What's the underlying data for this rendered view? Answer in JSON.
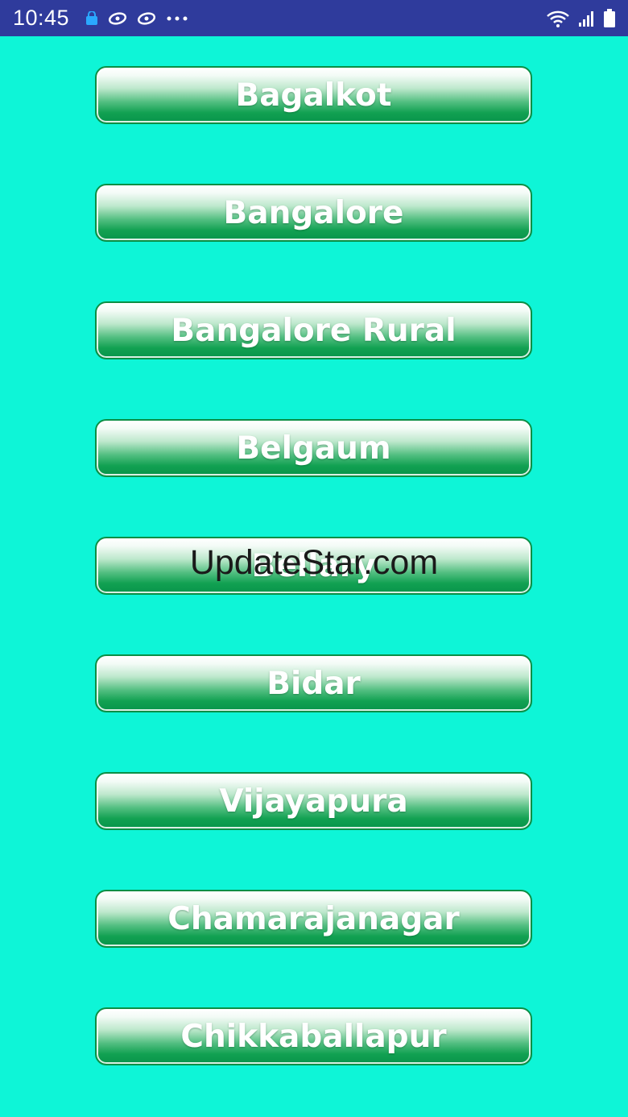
{
  "status_bar": {
    "time": "10:45",
    "background_color": "#2f3b9c",
    "left_icons": [
      "bag-icon",
      "swirl-icon",
      "swirl-icon",
      "more-dots-icon"
    ],
    "right_icons": [
      "wifi-icon",
      "signal-icon",
      "battery-icon"
    ]
  },
  "theme": {
    "background_color": "#0ef5d7",
    "button_gradient_top": "#ffffff",
    "button_gradient_bottom": "#07944a",
    "button_border": "#0a8f45",
    "button_text": "#ffffff"
  },
  "districts": [
    "Bagalkot",
    "Bangalore",
    "Bangalore Rural",
    "Belgaum",
    "Bellary",
    "Bidar",
    "Vijayapura",
    "Chamarajanagar",
    "Chikkaballapur"
  ],
  "watermark": "UpdateStar.com"
}
